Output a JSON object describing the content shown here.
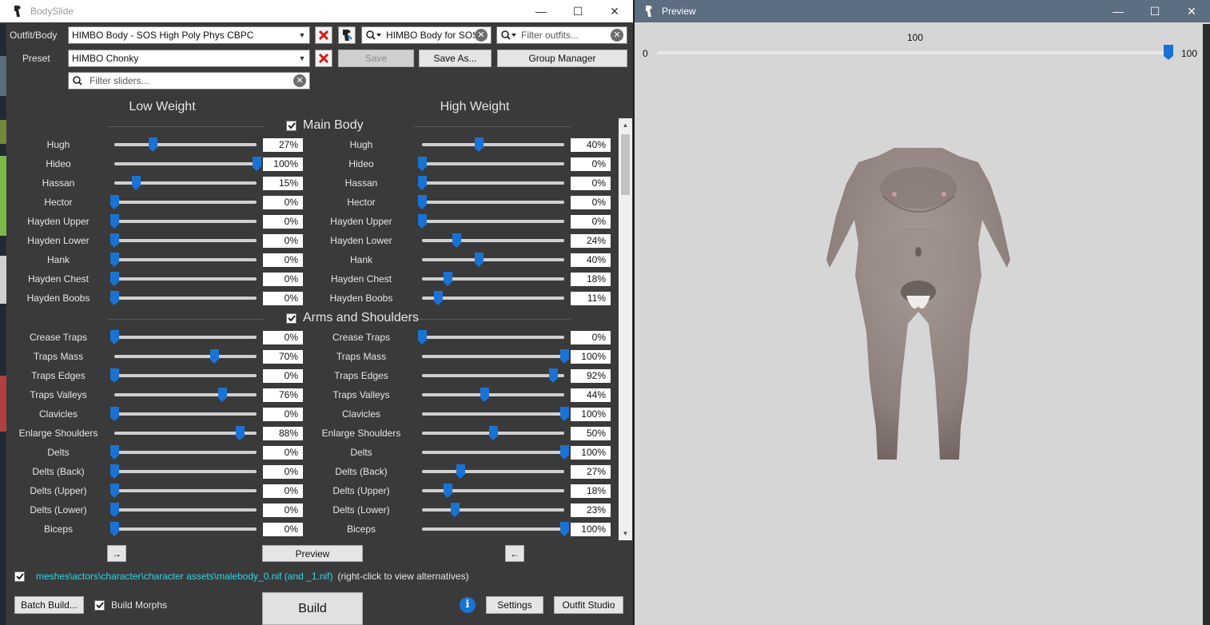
{
  "bodyslide": {
    "title": "BodySlide",
    "outfit_label": "Outfit/Body",
    "outfit_value": "HIMBO Body - SOS High Poly Phys CBPC",
    "outfit_search": "HIMBO Body for SOS",
    "filter_outfits_placeholder": "Filter outfits...",
    "preset_label": "Preset",
    "preset_value": "HIMBO Chonky",
    "save_label": "Save",
    "save_as_label": "Save As...",
    "group_manager_label": "Group Manager",
    "filter_sliders_placeholder": "Filter sliders...",
    "low_weight_label": "Low Weight",
    "high_weight_label": "High Weight",
    "sections": [
      {
        "name": "Main Body",
        "checked": true,
        "sliders": [
          {
            "name": "Hugh",
            "low": 27,
            "high": 40,
            "low_text": "27%",
            "high_text": "40%"
          },
          {
            "name": "Hideo",
            "low": 100,
            "high": 0,
            "low_text": "100%",
            "high_text": "0%"
          },
          {
            "name": "Hassan",
            "low": 15,
            "high": 0,
            "low_text": "15%",
            "high_text": "0%"
          },
          {
            "name": "Hector",
            "low": 0,
            "high": 0,
            "low_text": "0%",
            "high_text": "0%"
          },
          {
            "name": "Hayden Upper",
            "low": 0,
            "high": 0,
            "low_text": "0%",
            "high_text": "0%"
          },
          {
            "name": "Hayden Lower",
            "low": 0,
            "high": 24,
            "low_text": "0%",
            "high_text": "24%"
          },
          {
            "name": "Hank",
            "low": 0,
            "high": 40,
            "low_text": "0%",
            "high_text": "40%"
          },
          {
            "name": "Hayden Chest",
            "low": 0,
            "high": 18,
            "low_text": "0%",
            "high_text": "18%"
          },
          {
            "name": "Hayden Boobs",
            "low": 0,
            "high": 11,
            "low_text": "0%",
            "high_text": "11%"
          }
        ]
      },
      {
        "name": "Arms and Shoulders",
        "checked": true,
        "sliders": [
          {
            "name": "Crease Traps",
            "low": 0,
            "high": 0,
            "low_text": "0%",
            "high_text": "0%"
          },
          {
            "name": "Traps Mass",
            "low": 70,
            "high": 100,
            "low_text": "70%",
            "high_text": "100%"
          },
          {
            "name": "Traps Edges",
            "low": 0,
            "high": 92,
            "low_text": "0%",
            "high_text": "92%"
          },
          {
            "name": "Traps Valleys",
            "low": 76,
            "high": 44,
            "low_text": "76%",
            "high_text": "44%"
          },
          {
            "name": "Clavicles",
            "low": 0,
            "high": 100,
            "low_text": "0%",
            "high_text": "100%"
          },
          {
            "name": "Enlarge Shoulders",
            "low": 88,
            "high": 50,
            "low_text": "88%",
            "high_text": "50%"
          },
          {
            "name": "Delts",
            "low": 0,
            "high": 100,
            "low_text": "0%",
            "high_text": "100%"
          },
          {
            "name": "Delts (Back)",
            "low": 0,
            "high": 27,
            "low_text": "0%",
            "high_text": "27%"
          },
          {
            "name": "Delts (Upper)",
            "low": 0,
            "high": 18,
            "low_text": "0%",
            "high_text": "18%"
          },
          {
            "name": "Delts (Lower)",
            "low": 0,
            "high": 23,
            "low_text": "0%",
            "high_text": "23%"
          },
          {
            "name": "Biceps",
            "low": 0,
            "high": 100,
            "low_text": "0%",
            "high_text": "100%"
          }
        ]
      }
    ],
    "copy_right_arrow": "→",
    "preview_label": "Preview",
    "copy_left_arrow": "←",
    "nif_path": "meshes\\actors\\character\\character assets\\malebody_0.nif (and _1.nif)",
    "nif_hint": "(right-click to view alternatives)",
    "batch_build_label": "Batch Build...",
    "build_morphs_label": "Build Morphs",
    "build_morphs_checked": true,
    "build_label": "Build",
    "info_glyph": "i",
    "settings_label": "Settings",
    "outfit_studio_label": "Outfit Studio"
  },
  "preview": {
    "title": "Preview",
    "weight_value_label": "100",
    "weight_min_label": "0",
    "weight_max_label": "100",
    "weight_value": 100
  },
  "colors": {
    "accent": "#1a73d4",
    "panel_bg": "#3a3a3a",
    "preview_bg": "#d6d6d6",
    "path_text": "#2fd6e6",
    "clear_red": "#d11a1a"
  },
  "icons": {
    "app": "bodyslide-logo-icon",
    "search": "search-dropdown-icon",
    "clear": "clear-x-icon",
    "delete": "red-x-icon",
    "outfit_studio": "outfit-studio-icon",
    "info": "info-icon"
  }
}
